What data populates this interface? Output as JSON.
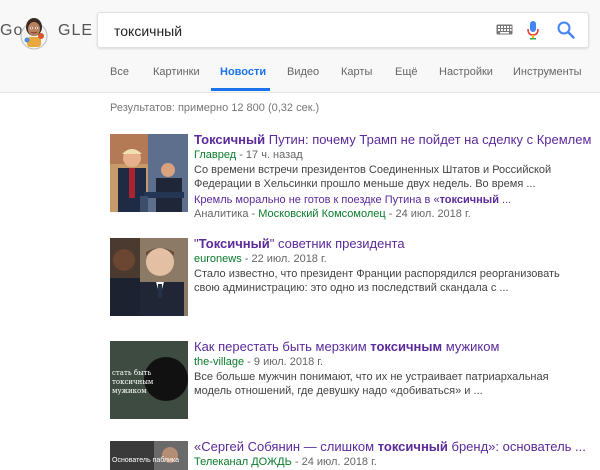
{
  "logo": {
    "left": "Go",
    "right": "GLE"
  },
  "search": {
    "query": "токсичный"
  },
  "tabs": [
    {
      "label": "Все"
    },
    {
      "label": "Картинки"
    },
    {
      "label": "Новости",
      "active": true
    },
    {
      "label": "Видео"
    },
    {
      "label": "Карты"
    },
    {
      "label": "Ещё"
    },
    {
      "label": "Настройки"
    },
    {
      "label": "Инструменты"
    }
  ],
  "stats": "Результатов: примерно 12 800 (0,32 сек.)",
  "results": [
    {
      "title_bold": "Токсичный",
      "title_rest": " Путин: почему Трамп не пойдет на сделку с Кремлем",
      "source": "Главред",
      "time": " - 17 ч. назад",
      "snippet": "Со времени встречи президентов Соединенных Штатов и Российской Федерации в Хельсинки прошло меньше двух недель. Во время ...",
      "sub_title_pre": "Кремль морально не готов к поездке Путина в «",
      "sub_title_bold": "токсичный",
      "sub_title_post": " ...",
      "sub_source_pre": "Аналитика - ",
      "sub_source": "Московский Комсомолец",
      "sub_time": " - 24 июл. 2018 г."
    },
    {
      "title_pre": "\"",
      "title_bold": "Токсичный",
      "title_rest": "\" советник президента",
      "source": "euronews",
      "time": " - 22 июл. 2018 г.",
      "snippet": "Стало известно, что президент Франции распорядился реорганизовать свою администрацию: это одно из последствий скандала с ..."
    },
    {
      "title_pre": "Как перестать быть мерзким ",
      "title_bold": "токсичным",
      "title_rest": " мужиком",
      "source": "the-village",
      "time": " - 9 июл. 2018 г.",
      "snippet": "Все больше мужчин понимают, что их не устраивает патриархальная модель отношений, где девушку надо «добиваться» и ...",
      "thumb_text": "стать быть\nтоксичным мужиком"
    },
    {
      "title_pre": "«Сергей Собянин — слишком ",
      "title_bold": "токсичный",
      "title_rest": " бренд»: основатель ...",
      "source": "Телеканал ДОЖДЬ",
      "time": " - 24 июл. 2018 г.",
      "thumb_text": "Основатель паблика"
    }
  ]
}
